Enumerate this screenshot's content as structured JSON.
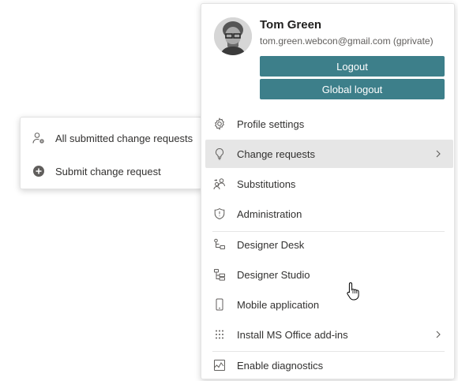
{
  "user": {
    "name": "Tom Green",
    "email": "tom.green.webcon@gmail.com (gprivate)",
    "avatar_icon": "user-photo"
  },
  "buttons": {
    "logout": "Logout",
    "global_logout": "Global logout"
  },
  "accent_color": "#3d7f8a",
  "menu_items": [
    {
      "label": "Profile settings",
      "icon": "gear-icon"
    },
    {
      "label": "Change requests",
      "icon": "lightbulb-icon",
      "active": true,
      "has_submenu": true
    },
    {
      "label": "Substitutions",
      "icon": "people-swap-icon"
    },
    {
      "label": "Administration",
      "icon": "shield-icon"
    },
    {
      "label": "Designer Desk",
      "icon": "flow-icon"
    },
    {
      "label": "Designer Studio",
      "icon": "hierarchy-icon"
    },
    {
      "label": "Mobile application",
      "icon": "phone-icon"
    },
    {
      "label": "Install MS Office add-ins",
      "icon": "grid-dots-icon",
      "has_submenu": true
    },
    {
      "label": "Enable diagnostics",
      "icon": "chart-icon"
    }
  ],
  "submenu": {
    "items": [
      {
        "label": "All submitted change requests",
        "icon": "person-settings-icon"
      },
      {
        "label": "Submit change request",
        "icon": "add-circle-icon"
      }
    ]
  }
}
